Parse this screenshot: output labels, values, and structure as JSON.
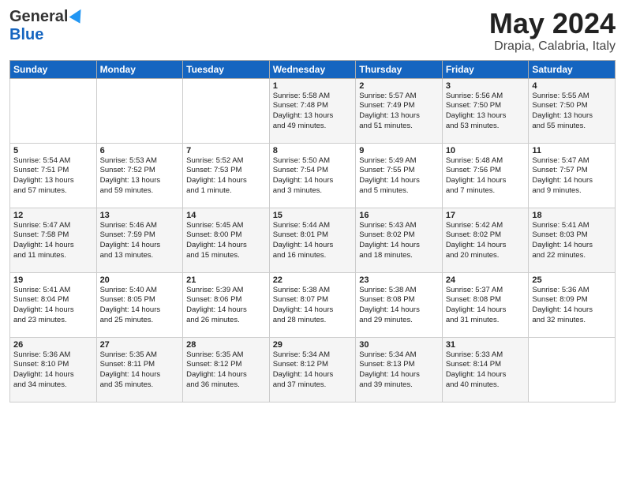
{
  "header": {
    "logo_line1": "General",
    "logo_line2": "Blue",
    "title": "May 2024",
    "location": "Drapia, Calabria, Italy"
  },
  "days_of_week": [
    "Sunday",
    "Monday",
    "Tuesday",
    "Wednesday",
    "Thursday",
    "Friday",
    "Saturday"
  ],
  "weeks": [
    [
      {
        "day": "",
        "info": ""
      },
      {
        "day": "",
        "info": ""
      },
      {
        "day": "",
        "info": ""
      },
      {
        "day": "1",
        "info": "Sunrise: 5:58 AM\nSunset: 7:48 PM\nDaylight: 13 hours\nand 49 minutes."
      },
      {
        "day": "2",
        "info": "Sunrise: 5:57 AM\nSunset: 7:49 PM\nDaylight: 13 hours\nand 51 minutes."
      },
      {
        "day": "3",
        "info": "Sunrise: 5:56 AM\nSunset: 7:50 PM\nDaylight: 13 hours\nand 53 minutes."
      },
      {
        "day": "4",
        "info": "Sunrise: 5:55 AM\nSunset: 7:50 PM\nDaylight: 13 hours\nand 55 minutes."
      }
    ],
    [
      {
        "day": "5",
        "info": "Sunrise: 5:54 AM\nSunset: 7:51 PM\nDaylight: 13 hours\nand 57 minutes."
      },
      {
        "day": "6",
        "info": "Sunrise: 5:53 AM\nSunset: 7:52 PM\nDaylight: 13 hours\nand 59 minutes."
      },
      {
        "day": "7",
        "info": "Sunrise: 5:52 AM\nSunset: 7:53 PM\nDaylight: 14 hours\nand 1 minute."
      },
      {
        "day": "8",
        "info": "Sunrise: 5:50 AM\nSunset: 7:54 PM\nDaylight: 14 hours\nand 3 minutes."
      },
      {
        "day": "9",
        "info": "Sunrise: 5:49 AM\nSunset: 7:55 PM\nDaylight: 14 hours\nand 5 minutes."
      },
      {
        "day": "10",
        "info": "Sunrise: 5:48 AM\nSunset: 7:56 PM\nDaylight: 14 hours\nand 7 minutes."
      },
      {
        "day": "11",
        "info": "Sunrise: 5:47 AM\nSunset: 7:57 PM\nDaylight: 14 hours\nand 9 minutes."
      }
    ],
    [
      {
        "day": "12",
        "info": "Sunrise: 5:47 AM\nSunset: 7:58 PM\nDaylight: 14 hours\nand 11 minutes."
      },
      {
        "day": "13",
        "info": "Sunrise: 5:46 AM\nSunset: 7:59 PM\nDaylight: 14 hours\nand 13 minutes."
      },
      {
        "day": "14",
        "info": "Sunrise: 5:45 AM\nSunset: 8:00 PM\nDaylight: 14 hours\nand 15 minutes."
      },
      {
        "day": "15",
        "info": "Sunrise: 5:44 AM\nSunset: 8:01 PM\nDaylight: 14 hours\nand 16 minutes."
      },
      {
        "day": "16",
        "info": "Sunrise: 5:43 AM\nSunset: 8:02 PM\nDaylight: 14 hours\nand 18 minutes."
      },
      {
        "day": "17",
        "info": "Sunrise: 5:42 AM\nSunset: 8:02 PM\nDaylight: 14 hours\nand 20 minutes."
      },
      {
        "day": "18",
        "info": "Sunrise: 5:41 AM\nSunset: 8:03 PM\nDaylight: 14 hours\nand 22 minutes."
      }
    ],
    [
      {
        "day": "19",
        "info": "Sunrise: 5:41 AM\nSunset: 8:04 PM\nDaylight: 14 hours\nand 23 minutes."
      },
      {
        "day": "20",
        "info": "Sunrise: 5:40 AM\nSunset: 8:05 PM\nDaylight: 14 hours\nand 25 minutes."
      },
      {
        "day": "21",
        "info": "Sunrise: 5:39 AM\nSunset: 8:06 PM\nDaylight: 14 hours\nand 26 minutes."
      },
      {
        "day": "22",
        "info": "Sunrise: 5:38 AM\nSunset: 8:07 PM\nDaylight: 14 hours\nand 28 minutes."
      },
      {
        "day": "23",
        "info": "Sunrise: 5:38 AM\nSunset: 8:08 PM\nDaylight: 14 hours\nand 29 minutes."
      },
      {
        "day": "24",
        "info": "Sunrise: 5:37 AM\nSunset: 8:08 PM\nDaylight: 14 hours\nand 31 minutes."
      },
      {
        "day": "25",
        "info": "Sunrise: 5:36 AM\nSunset: 8:09 PM\nDaylight: 14 hours\nand 32 minutes."
      }
    ],
    [
      {
        "day": "26",
        "info": "Sunrise: 5:36 AM\nSunset: 8:10 PM\nDaylight: 14 hours\nand 34 minutes."
      },
      {
        "day": "27",
        "info": "Sunrise: 5:35 AM\nSunset: 8:11 PM\nDaylight: 14 hours\nand 35 minutes."
      },
      {
        "day": "28",
        "info": "Sunrise: 5:35 AM\nSunset: 8:12 PM\nDaylight: 14 hours\nand 36 minutes."
      },
      {
        "day": "29",
        "info": "Sunrise: 5:34 AM\nSunset: 8:12 PM\nDaylight: 14 hours\nand 37 minutes."
      },
      {
        "day": "30",
        "info": "Sunrise: 5:34 AM\nSunset: 8:13 PM\nDaylight: 14 hours\nand 39 minutes."
      },
      {
        "day": "31",
        "info": "Sunrise: 5:33 AM\nSunset: 8:14 PM\nDaylight: 14 hours\nand 40 minutes."
      },
      {
        "day": "",
        "info": ""
      }
    ]
  ]
}
